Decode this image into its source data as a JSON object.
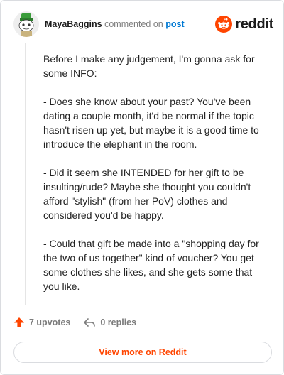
{
  "comment": {
    "username": "MayaBaggins",
    "verb": "commented on",
    "link_text": "post",
    "paragraphs": [
      "Before I make any judgement, I'm gonna ask for some INFO:",
      "- Does she know about your past? You've been dating a couple month, it'd be normal if the topic hasn't risen up yet, but maybe it is a good time to introduce the elephant in the room.",
      "- Did it seem she INTENDED for her gift to be insulting/rude? Maybe she thought you couldn't afford \"stylish\" (from her PoV) clothes and considered you'd be happy.",
      "- Could that gift be made into a \"shopping day for the two of us together\" kind of voucher? You get some clothes she likes, and she gets some that you like."
    ]
  },
  "brand": {
    "name": "reddit",
    "icon": "reddit-logo-icon",
    "accent": "#ff4500"
  },
  "actions": {
    "upvotes": "7 upvotes",
    "replies": "0 replies"
  },
  "footer": {
    "view_more_label": "View more on Reddit"
  },
  "colors": {
    "link": "#0079d3",
    "muted": "#7c7c7c",
    "accent": "#ff4500"
  }
}
